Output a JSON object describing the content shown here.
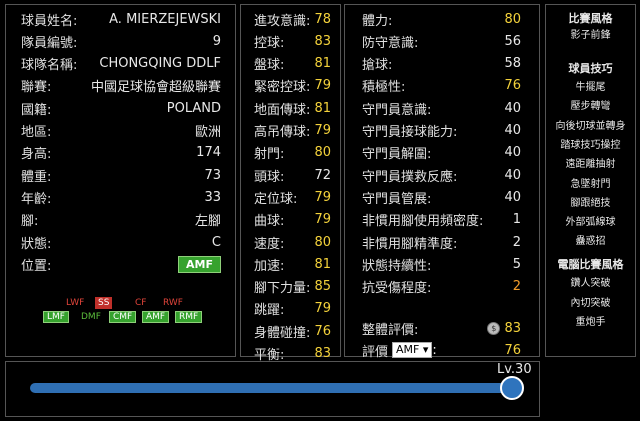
{
  "profile": [
    {
      "label": "球員姓名:",
      "value": "A. MIERZEJEWSKI"
    },
    {
      "label": "隊員編號:",
      "value": "9"
    },
    {
      "label": "球隊名稱:",
      "value": "CHONGQING DDLF"
    },
    {
      "label": "聯賽:",
      "value": "中國足球協會超級聯賽"
    },
    {
      "label": "國籍:",
      "value": "POLAND"
    },
    {
      "label": "地區:",
      "value": "歐洲"
    },
    {
      "label": "身高:",
      "value": "174"
    },
    {
      "label": "體重:",
      "value": "73"
    },
    {
      "label": "年齡:",
      "value": "33"
    },
    {
      "label": "腳:",
      "value": "左腳"
    },
    {
      "label": "狀態:",
      "value": "C"
    },
    {
      "label": "位置:",
      "value": "AMF"
    }
  ],
  "positions": [
    "LWF",
    "SS",
    "CF",
    "RWF",
    "LMF",
    "DMF",
    "CMF",
    "AMF",
    "RMF"
  ],
  "stats_mid": [
    {
      "label": "進攻意識:",
      "value": "78",
      "color": "yellow"
    },
    {
      "label": "控球:",
      "value": "83",
      "color": "yellow"
    },
    {
      "label": "盤球:",
      "value": "81",
      "color": "yellow"
    },
    {
      "label": "緊密控球:",
      "value": "79",
      "color": "yellow"
    },
    {
      "label": "地面傳球:",
      "value": "81",
      "color": "yellow"
    },
    {
      "label": "高吊傳球:",
      "value": "79",
      "color": "yellow"
    },
    {
      "label": "射門:",
      "value": "80",
      "color": "yellow"
    },
    {
      "label": "頭球:",
      "value": "72",
      "color": "white"
    },
    {
      "label": "定位球:",
      "value": "79",
      "color": "yellow"
    },
    {
      "label": "曲球:",
      "value": "79",
      "color": "yellow"
    },
    {
      "label": "速度:",
      "value": "80",
      "color": "yellow"
    },
    {
      "label": "加速:",
      "value": "81",
      "color": "yellow"
    },
    {
      "label": "腳下力量:",
      "value": "85",
      "color": "yellow"
    },
    {
      "label": "跳躍:",
      "value": "79",
      "color": "yellow"
    },
    {
      "label": "身體碰撞:",
      "value": "76",
      "color": "yellow"
    },
    {
      "label": "平衡:",
      "value": "83",
      "color": "yellow"
    }
  ],
  "stats_right": [
    {
      "label": "體力:",
      "value": "80",
      "color": "yellow"
    },
    {
      "label": "防守意識:",
      "value": "56",
      "color": "white"
    },
    {
      "label": "搶球:",
      "value": "58",
      "color": "white"
    },
    {
      "label": "積極性:",
      "value": "76",
      "color": "yellow"
    },
    {
      "label": "守門員意識:",
      "value": "40",
      "color": "white"
    },
    {
      "label": "守門員接球能力:",
      "value": "40",
      "color": "white"
    },
    {
      "label": "守門員解圍:",
      "value": "40",
      "color": "white"
    },
    {
      "label": "守門員撲救反應:",
      "value": "40",
      "color": "white"
    },
    {
      "label": "守門員管展:",
      "value": "40",
      "color": "white"
    },
    {
      "label": "非慣用腳使用頻密度:",
      "value": "1",
      "color": "white"
    },
    {
      "label": "非慣用腳精準度:",
      "value": "2",
      "color": "white"
    },
    {
      "label": "狀態持續性:",
      "value": "5",
      "color": "white"
    },
    {
      "label": "抗受傷程度:",
      "value": "2",
      "color": "orange"
    }
  ],
  "overall": {
    "label": "整體評價:",
    "value": "83"
  },
  "rating": {
    "label": "評價",
    "position": "AMF",
    "value": "76"
  },
  "sidebar": {
    "style_title": "比賽風格",
    "style_items": [
      "影子前鋒"
    ],
    "skill_title": "球員技巧",
    "skill_items": [
      "牛擺尾",
      "壓步轉彎",
      "向後切球並轉身",
      "踏球技巧操控",
      "遠距離抽射",
      "急墜射門",
      "腳跟絕技",
      "外部弧線球",
      "蠱惑招"
    ],
    "ai_title": "電腦比賽風格",
    "ai_items": [
      "鑽人突破",
      "內切突破",
      "重炮手"
    ]
  },
  "level": {
    "label": "Lv.30",
    "fraction": 1.0
  }
}
